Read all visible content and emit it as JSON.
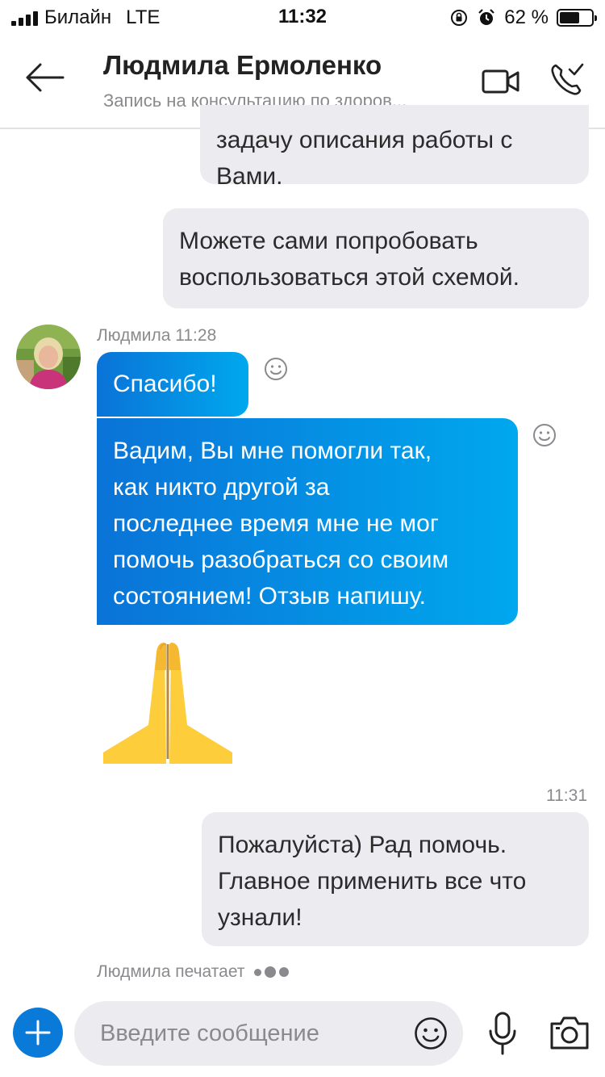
{
  "status_bar": {
    "carrier": "Билайн",
    "network": "LTE",
    "time": "11:32",
    "battery": "62 %",
    "battery_level": 0.62
  },
  "header": {
    "title": "Людмила Ермоленко",
    "subtitle": "Запись на консультацию по здоров..."
  },
  "messages": {
    "out_1": {
      "lines": [
        "задачу описания работы с",
        "Вами."
      ]
    },
    "out_2": {
      "lines": [
        "Можете сами попробовать",
        "воспользоваться этой схемой."
      ]
    },
    "incoming_meta": "Людмила 11:28",
    "in_1": {
      "lines": [
        "Спасибо!"
      ]
    },
    "in_2": {
      "lines": [
        "Вадим, Вы мне помогли так,",
        "как никто другой за",
        "последнее время мне не мог",
        "помочь разобраться со своим",
        "состоянием!  Отзыв напишу."
      ]
    },
    "emoji_reaction": "folded-hands",
    "out_3_time": "11:31",
    "out_3": {
      "lines": [
        "Пожалуйста) Рад помочь.",
        "Главное применить все что",
        "узнали!"
      ]
    }
  },
  "typing_indicator": "Людмила печатает",
  "composer": {
    "placeholder": "Введите сообщение"
  },
  "colors": {
    "accent": "#0a7ad8",
    "bubble_gradient_start": "#0a73d7",
    "bubble_gradient_end": "#00a8ee",
    "outgoing_bubble": "#ebebf0"
  }
}
